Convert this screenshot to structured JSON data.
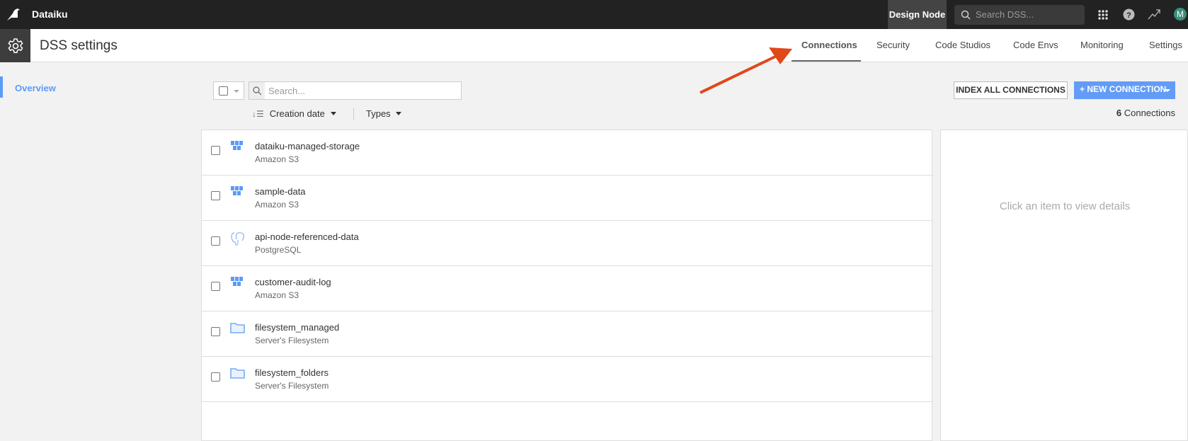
{
  "topbar": {
    "app_name": "Dataiku",
    "node_label": "Design Node",
    "search_placeholder": "Search DSS...",
    "avatar_initial": "M"
  },
  "header": {
    "title": "DSS settings",
    "tabs": [
      {
        "label": "Connections",
        "active": true
      },
      {
        "label": "Security"
      },
      {
        "label": "Code Studios"
      },
      {
        "label": "Code Envs"
      },
      {
        "label": "Monitoring"
      },
      {
        "label": "Settings"
      }
    ]
  },
  "sidebar": {
    "items": [
      {
        "label": "Overview",
        "active": true
      }
    ]
  },
  "toolbar": {
    "search_placeholder": "Search...",
    "sort_label": "Creation date",
    "types_label": "Types",
    "index_all_label": "INDEX ALL CONNECTIONS",
    "new_connection_label": "+ NEW CONNECTION",
    "count": "6",
    "count_suffix": "Connections"
  },
  "connections": [
    {
      "name": "dataiku-managed-storage",
      "type": "Amazon S3",
      "icon": "s3-icon"
    },
    {
      "name": "sample-data",
      "type": "Amazon S3",
      "icon": "s3-icon"
    },
    {
      "name": "api-node-referenced-data",
      "type": "PostgreSQL",
      "icon": "postgresql-icon"
    },
    {
      "name": "customer-audit-log",
      "type": "Amazon S3",
      "icon": "s3-icon"
    },
    {
      "name": "filesystem_managed",
      "type": "Server's Filesystem",
      "icon": "folder-icon"
    },
    {
      "name": "filesystem_folders",
      "type": "Server's Filesystem",
      "icon": "folder-icon"
    }
  ],
  "detail": {
    "empty_text": "Click an item to view details"
  },
  "colors": {
    "accent": "#5b9bf8",
    "annotation_arrow": "#e0481a",
    "topbar": "#222222"
  }
}
